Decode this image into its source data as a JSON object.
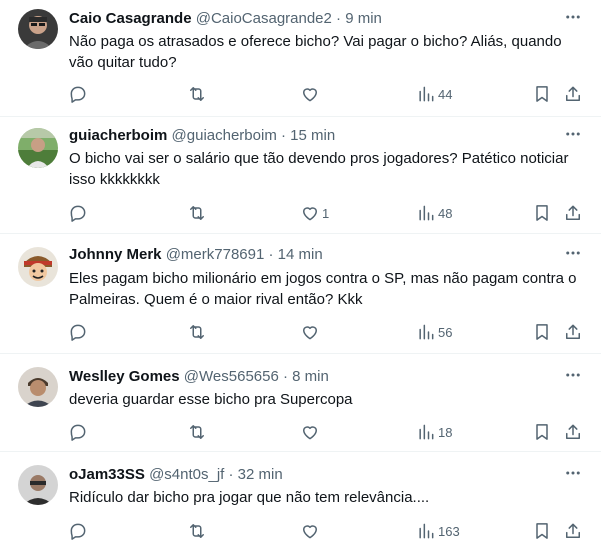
{
  "tweets": [
    {
      "name": "Caio Casagrande",
      "handle": "@CaioCasagrande2",
      "time": "9 min",
      "text": "Não paga os atrasados e oferece bicho? Vai pagar o bicho? Aliás, quando vão quitar tudo?",
      "replies": "",
      "retweets": "",
      "likes": "",
      "views": "44"
    },
    {
      "name": "guiacherboim",
      "handle": "@guiacherboim",
      "time": "15 min",
      "text": "O bicho vai ser o salário que tão devendo pros jogadores? Patético noticiar isso kkkkkkkk",
      "replies": "",
      "retweets": "",
      "likes": "1",
      "views": "48"
    },
    {
      "name": "Johnny Merk",
      "handle": "@merk778691",
      "time": "14 min",
      "text": "Eles pagam bicho milionário em jogos contra o SP, mas não pagam contra o Palmeiras. Quem é o maior rival então? Kkk",
      "replies": "",
      "retweets": "",
      "likes": "",
      "views": "56"
    },
    {
      "name": "Weslley Gomes",
      "handle": "@Wes565656",
      "time": "8 min",
      "text": "deveria guardar esse bicho pra Supercopa",
      "replies": "",
      "retweets": "",
      "likes": "",
      "views": "18"
    },
    {
      "name": "oJam33SS",
      "handle": "@s4nt0s_jf",
      "time": "32 min",
      "text": "Ridículo dar bicho pra jogar que não tem relevância....",
      "replies": "",
      "retweets": "",
      "likes": "",
      "views": "163"
    }
  ],
  "separator": "·",
  "icons": {
    "reply": "reply-icon",
    "retweet": "retweet-icon",
    "like": "heart-icon",
    "views": "views-icon",
    "bookmark": "bookmark-icon",
    "share": "share-icon",
    "more": "more-icon"
  },
  "colors": {
    "text": "#0f1419",
    "secondary": "#536471",
    "border": "#eff3f4"
  }
}
